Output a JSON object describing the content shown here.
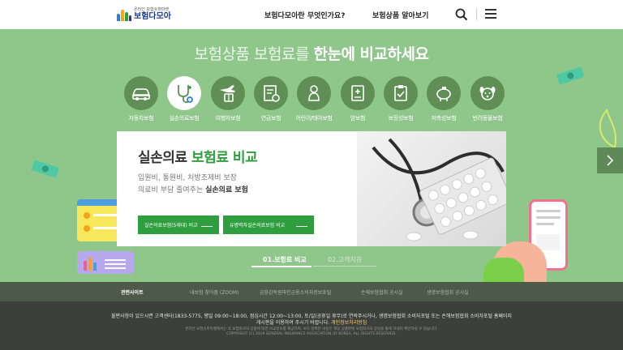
{
  "header": {
    "logo_sub": "온라인 보험슈퍼마켓",
    "logo_main": "보험다모아",
    "nav": [
      "보험다모아란 무엇인가요?",
      "보험상품 알아보기"
    ]
  },
  "hero": {
    "title_prefix": "보험상품 보험료를",
    "title_bold": "한눈에 비교하세요",
    "categories": [
      {
        "label": "자동차보험",
        "icon": "car-icon"
      },
      {
        "label": "실손의료보험",
        "icon": "stethoscope-icon"
      },
      {
        "label": "여행자보험",
        "icon": "airplane-luggage-icon"
      },
      {
        "label": "연금보험",
        "icon": "pension-document-icon"
      },
      {
        "label": "어린이/태아보험",
        "icon": "baby-icon"
      },
      {
        "label": "암보험",
        "icon": "medical-chart-icon"
      },
      {
        "label": "보장성보험",
        "icon": "clipboard-check-icon"
      },
      {
        "label": "저축성보험",
        "icon": "piggy-bank-icon"
      },
      {
        "label": "반려동물보험",
        "icon": "pet-dog-icon"
      }
    ],
    "active_category": 1
  },
  "card": {
    "title_plain": "실손의료",
    "title_highlight": "보험료 비교",
    "desc1": "입원비, 통원비, 처방조제비 보장",
    "desc2_prefix": "의료비 부담 줄여주는",
    "desc2_bold": "실손의료 보험",
    "button1": "실손의료보험(5세대) 비교",
    "button2": "유병력자실손의료보험 비교"
  },
  "tabs": [
    "01.보험료 비교",
    "02.고객지원"
  ],
  "related_sites": [
    "관련사이트",
    "내보험 찾아줌 (ZOOM)",
    "금융감독원파인금융소비자정보포털",
    "손해보험협회 공시실",
    "생명보험협회 공시실"
  ],
  "footer": {
    "line1": "불편사항이 있으시면 고객센터(1833-5775, 평일 09:00~18:00, 점심시간 12:00~13:00, 토/일(공휴일 휴무)로 연락주시거나, 생명보험협회 소비자포털 또는 손해보험협회 소비자포털 홈페이지",
    "line2_prefix": "게시판을 이용하여 주시기 바랍니다.",
    "line2_link": "개인정보처리방침",
    "line3": "온라인 보험슈퍼마켓에서는 각 보험회사의 상품에 대한 비교정보를 제공하며, 보다 정확한 내용은 해당 상품판매 보험회사의 상담을 통해 자세히 확인하실 수 있습니다.",
    "line4": "COPYRIGHT (C) 2019 GENERAL INSURANCE ASSOCIATION OF KOREA. ALL RIGHTS RESERVED."
  },
  "colors": {
    "hero_bg": "#8fc68a",
    "accent_green": "#2f9e3e",
    "category_circle": "#5f8f55",
    "related_bar": "#4d5a49",
    "footer_bg": "#3d3f3c"
  }
}
